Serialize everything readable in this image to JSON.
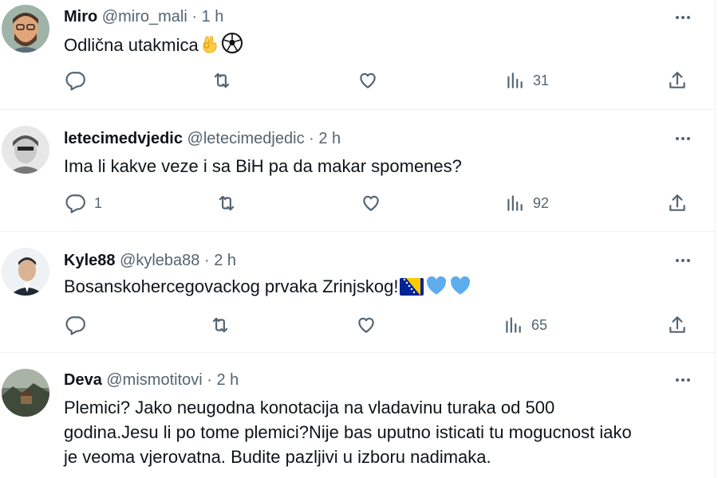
{
  "tweets": [
    {
      "name": "Miro",
      "handle": "@miro_mali",
      "separator": "·",
      "time": "1 h",
      "text": "Odlična utakmica",
      "emoji": [
        "ok-hand",
        "soccer-ball"
      ],
      "replies": "",
      "views": "31"
    },
    {
      "name": "letecimedvjedic",
      "handle": "@letecimedjedic",
      "separator": "·",
      "time": "2 h",
      "text": "Ima li kakve veze i sa BiH pa da makar spomenes?",
      "emoji": [],
      "replies": "1",
      "views": "92"
    },
    {
      "name": "Kyle88",
      "handle": "@kyleba88",
      "separator": "·",
      "time": "2 h",
      "text": "Bosanskohercegovackog prvaka Zrinjskog!",
      "emoji": [
        "bosnia-flag",
        "blue-heart",
        "blue-heart"
      ],
      "replies": "",
      "views": "65"
    },
    {
      "name": "Deva",
      "handle": "@mismotitovi",
      "separator": "·",
      "time": "2 h",
      "text_lines": [
        "Plemici? Jako neugodna konotacija na vladavinu turaka od 500",
        "godina.Jesu li po tome plemici?Nije bas uputno isticati tu mogucnost iako",
        "je veoma vjerovatna. Budite pazljivi u izboru nadimaka."
      ]
    }
  ],
  "colors": {
    "text": "#0f1419",
    "secondary": "#536471",
    "divider": "#eff3f4",
    "heart_blue": "#5dadec"
  }
}
